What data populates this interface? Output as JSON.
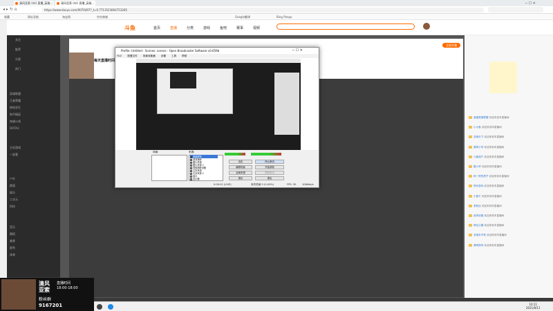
{
  "tabs": [
    {
      "label": "清风亚索 (lol) 直播_英雄..."
    },
    {
      "label": "清风亚索 (lol) 直播_英雄..."
    }
  ],
  "address": {
    "url": "https://www.douyu.com/9070497?_t=0.7713523664753285"
  },
  "bookmarks": [
    "收藏",
    "网址导航",
    "淘宝网",
    "京东商城",
    "Google翻译",
    "Bing Pangu"
  ],
  "site": {
    "logo": "斗鱼",
    "nav": [
      "首页",
      "直播",
      "分类",
      "游戏",
      "鱼吧",
      "赛事",
      "视频"
    ],
    "streamer_title": "每天直播时间",
    "gift_button": "立即开播"
  },
  "left_menu": [
    "关注",
    "推荐",
    "分类",
    "热门",
    "英雄联盟",
    "王者荣耀",
    "绝地求生",
    "和平精英",
    "穿越火线",
    "DOTA2",
    "主机游戏",
    "一起看",
    "户外",
    "颜值",
    "娱乐",
    "二次元",
    "科技",
    "音乐",
    "舞蹈",
    "美食",
    "星秀",
    "体育"
  ],
  "obs": {
    "title": "Profile: Untitled - Scenes: scenes - Open Broadcaster Software v0.659b",
    "menu": [
      "FILE",
      "配置文件",
      "场景收集器",
      "设置",
      "工具",
      "帮助"
    ],
    "sources_label": "来源:",
    "scenes_label": "场景:",
    "sources": [
      "英雄联盟",
      "游戏捕获",
      "图片来源",
      "图片来源 2",
      "视频捕获设备",
      "文本来源",
      "文本来源 2",
      "窗口",
      "显示器"
    ],
    "buttons": [
      "设定",
      "停止串流",
      "编辑场景",
      "开始录制",
      "全局来源",
      "预览串流",
      "退出",
      "退出"
    ],
    "status_left": "0:00:01 (LIVE)",
    "status_mid": "丢失的帧 0 (0.00%)",
    "status_fps": "FPS: 30",
    "status_kb": "1064kb/s"
  },
  "chat": [
    {
      "user": "我爱英雄联盟",
      "text": "欢迎来到本直播间"
    },
    {
      "user": "小小鱼",
      "text": "欢迎来到本直播间"
    },
    {
      "user": "亚索天下",
      "text": "欢迎来到本直播间"
    },
    {
      "user": "清风小号",
      "text": "欢迎来到本直播间"
    },
    {
      "user": "斗鱼用户",
      "text": "欢迎来到本直播间"
    },
    {
      "user": "路人甲",
      "text": "欢迎来到本直播间"
    },
    {
      "user": "风一样的男子",
      "text": "欢迎来到本直播间"
    },
    {
      "user": "快乐游戏",
      "text": "欢迎来到本直播间"
    },
    {
      "user": "小鱼干",
      "text": "欢迎来到本直播间"
    },
    {
      "user": "老粉丝",
      "text": "欢迎来到本直播间"
    },
    {
      "user": "疾风剑豪",
      "text": "欢迎来到本直播间"
    },
    {
      "user": "峡谷之巅",
      "text": "欢迎来到本直播间"
    },
    {
      "user": "亚索永不死",
      "text": "欢迎来到本直播间"
    },
    {
      "user": "清风徐来",
      "text": "欢迎来到本直播间"
    }
  ],
  "overlay": {
    "name_line1": "清风",
    "name_line2": "亚索",
    "time_label": "直播时间",
    "time_range": "18:00-18:00",
    "fans_label": "粉丝群",
    "qq_number": "9167201"
  },
  "taskbar": {
    "time": "10:11",
    "date": "2021/8/11"
  },
  "colors": {
    "accent": "#ff6b00",
    "chat_user": "#2d78d6",
    "overlay_text": "#ffffff"
  }
}
